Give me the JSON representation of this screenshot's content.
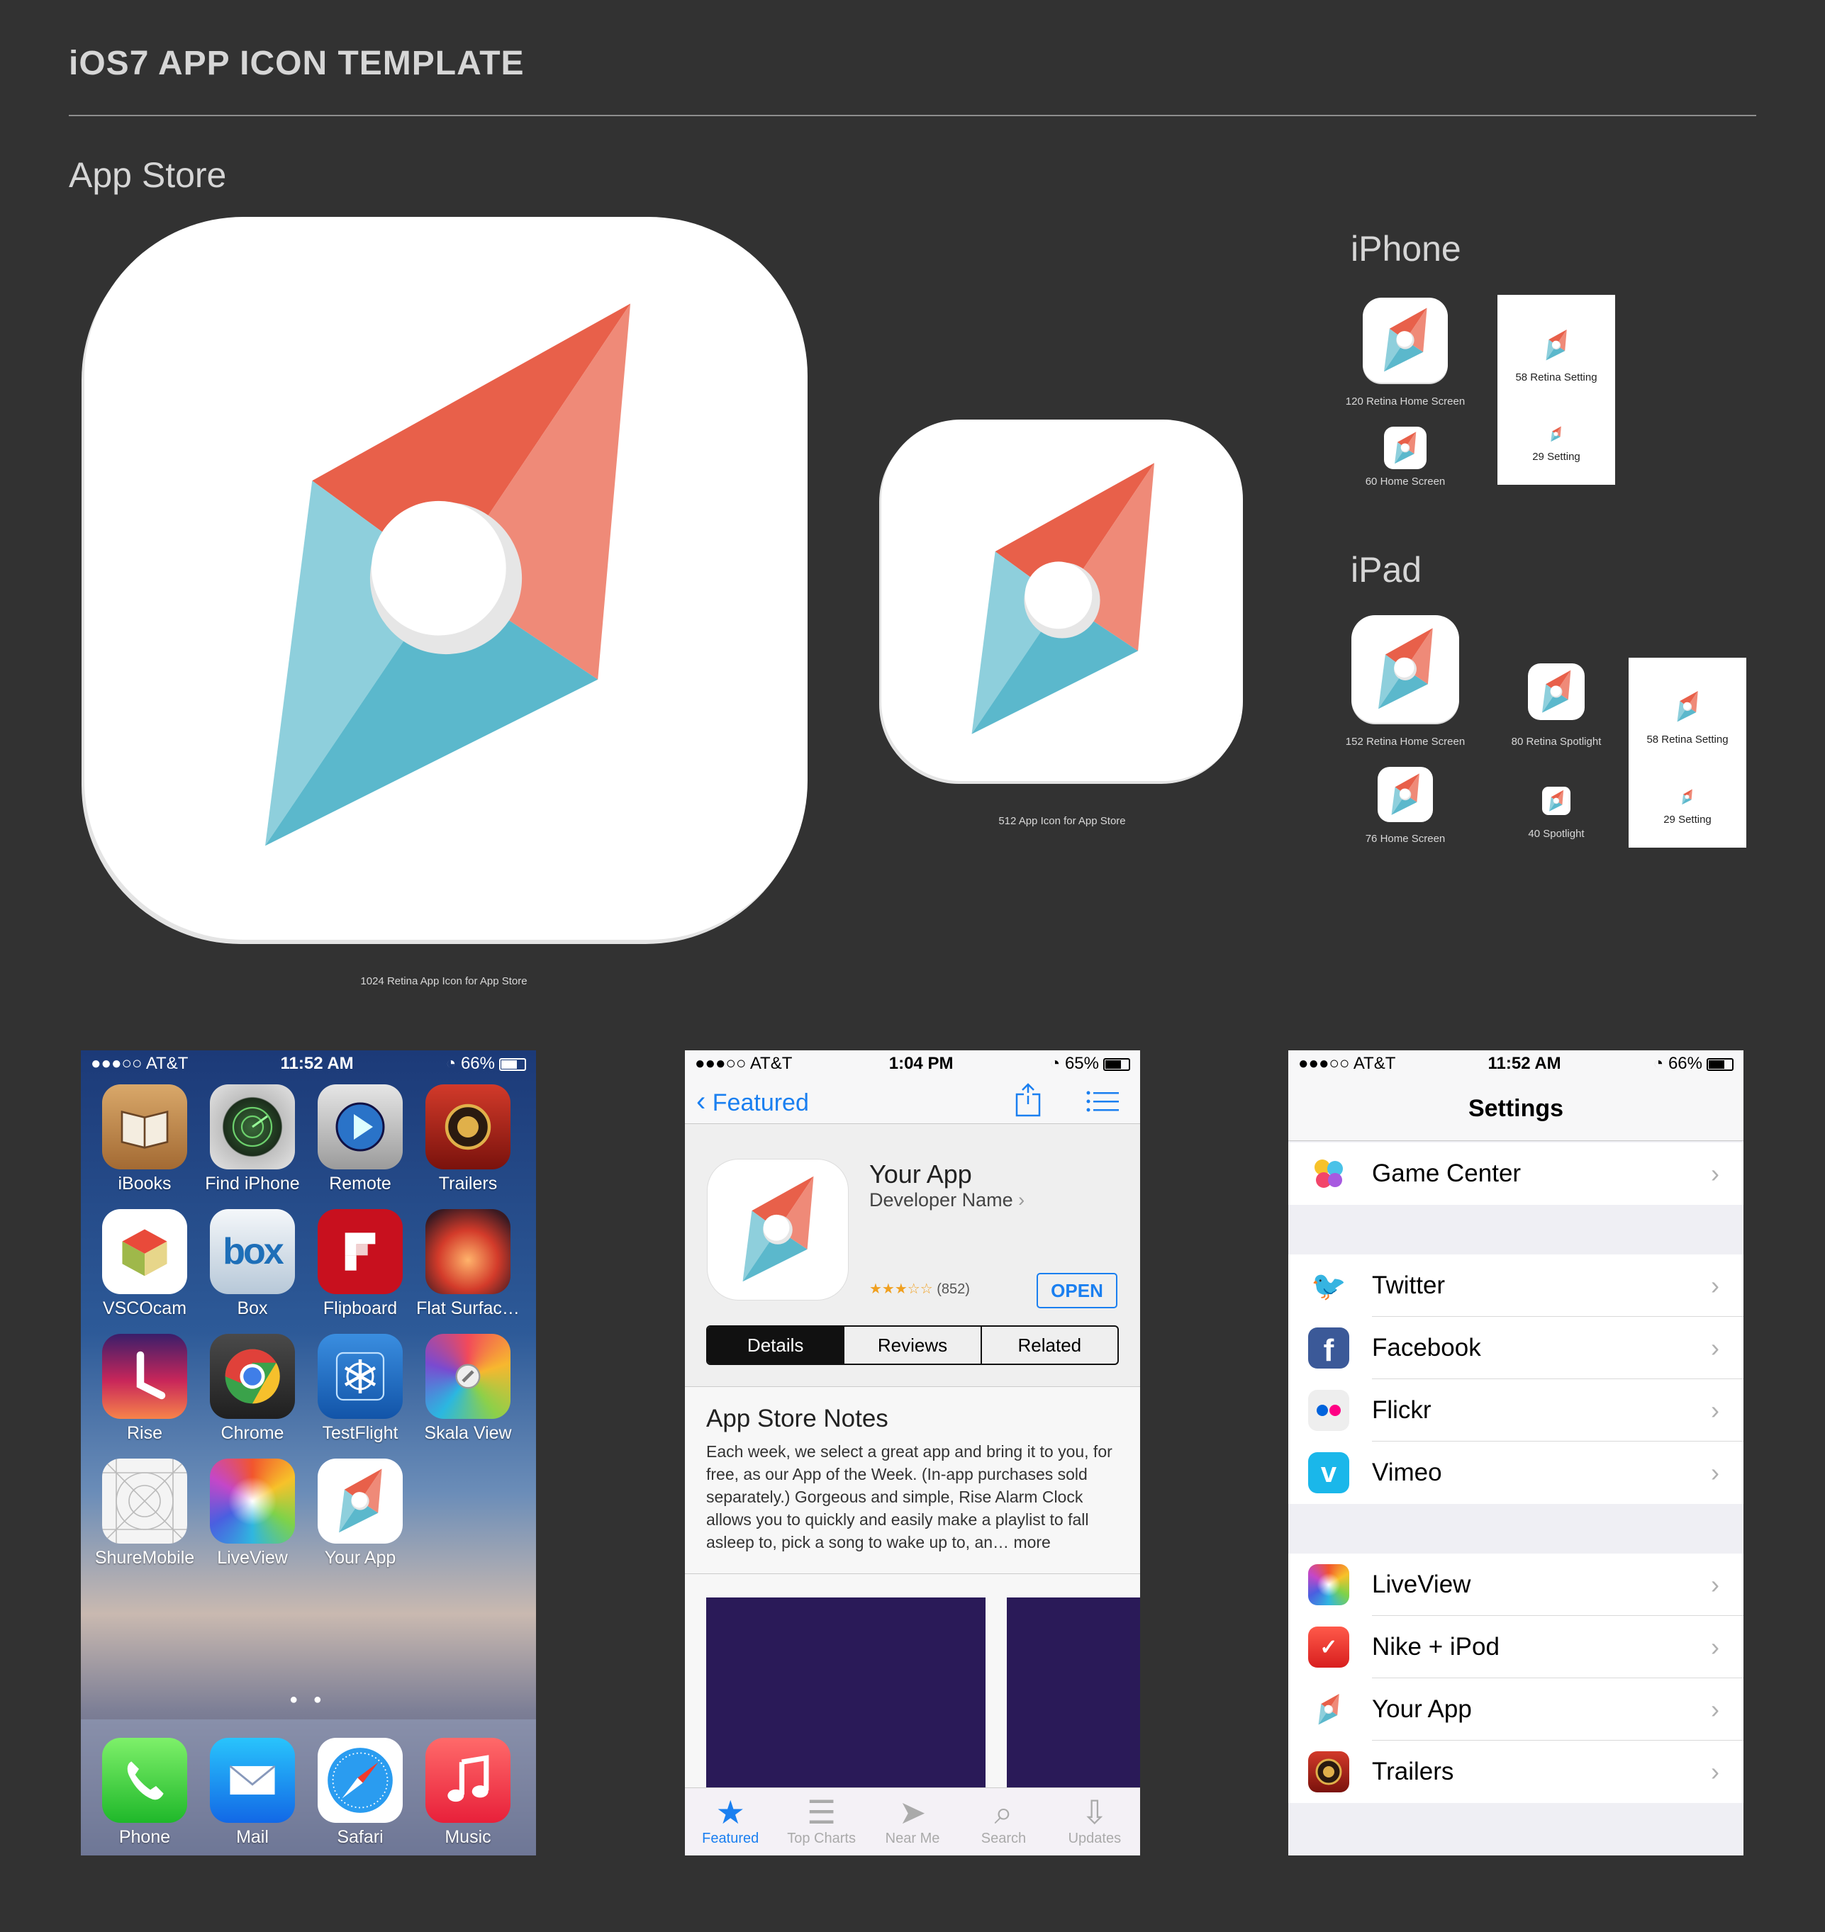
{
  "page": {
    "title": "iOS7 APP ICON TEMPLATE",
    "section_app_store": "App Store",
    "section_iphone": "iPhone",
    "section_ipad": "iPad"
  },
  "captions": {
    "c1024": "1024 Retina App Icon for App Store",
    "c512": "512 App Icon for App Store",
    "c120": "120 Retina Home Screen",
    "c60": "60 Home Screen",
    "c58_iphone": "58 Retina Setting",
    "c29_iphone": "29 Setting",
    "c152": "152 Retina Home Screen",
    "c76": "76 Home Screen",
    "c80": "80 Retina Spotlight",
    "c40": "40 Spotlight",
    "c58_ipad": "58 Retina Setting",
    "c29_ipad": "29 Setting"
  },
  "colors": {
    "background": "#323232",
    "red": "#e8604a",
    "salmon": "#ef8a78",
    "blue": "#5bb8cc",
    "lightblue": "#8ecfdc",
    "ios_blue": "#1a7ff0"
  },
  "home_phone": {
    "status": {
      "carrier": "●●●○○ AT&T",
      "time": "11:52 AM",
      "battery": "66%",
      "battery_level": 0.66
    },
    "apps": [
      {
        "label": "iBooks",
        "icon": "book-icon"
      },
      {
        "label": "Find iPhone",
        "icon": "radar-icon"
      },
      {
        "label": "Remote",
        "icon": "play-icon"
      },
      {
        "label": "Trailers",
        "icon": "film-icon"
      },
      {
        "label": "VSCOcam",
        "icon": "cube-icon"
      },
      {
        "label": "Box",
        "icon": "box-icon"
      },
      {
        "label": "Flipboard",
        "icon": "flipboard-icon"
      },
      {
        "label": "Flat Surfac…",
        "icon": "flatsurface-icon"
      },
      {
        "label": "Rise",
        "icon": "clock-icon"
      },
      {
        "label": "Chrome",
        "icon": "chrome-icon"
      },
      {
        "label": "TestFlight",
        "icon": "testflight-icon"
      },
      {
        "label": "Skala View",
        "icon": "skala-icon"
      },
      {
        "label": "ShureMobile",
        "icon": "grid-icon"
      },
      {
        "label": "LiveView",
        "icon": "liveview-icon"
      },
      {
        "label": "Your App",
        "icon": "compass-icon"
      }
    ],
    "dock": [
      {
        "label": "Phone",
        "icon": "phone-icon"
      },
      {
        "label": "Mail",
        "icon": "mail-icon"
      },
      {
        "label": "Safari",
        "icon": "safari-icon"
      },
      {
        "label": "Music",
        "icon": "music-icon"
      }
    ],
    "page_dots": "● ●"
  },
  "store_phone": {
    "status": {
      "carrier": "●●●○○ AT&T",
      "time": "1:04 PM",
      "battery": "65%",
      "battery_level": 0.65
    },
    "back_label": "Featured",
    "app_name": "Your App",
    "developer": "Developer Name",
    "stars": "★★★☆☆",
    "rating_count": "(852)",
    "open_label": "OPEN",
    "segments": [
      "Details",
      "Reviews",
      "Related"
    ],
    "notes_title": "App Store Notes",
    "notes_body": "Each week, we select a great app and bring it to you, for free, as our App of the Week. (In-app purchases sold separately.) Gorgeous and simple, Rise Alarm Clock allows you to quickly and easily make a playlist to fall asleep to, pick a song to wake up to, an…",
    "more_label": "more",
    "tabs": [
      {
        "label": "Featured",
        "icon": "star-icon"
      },
      {
        "label": "Top Charts",
        "icon": "list-icon"
      },
      {
        "label": "Near Me",
        "icon": "location-icon"
      },
      {
        "label": "Search",
        "icon": "search-icon"
      },
      {
        "label": "Updates",
        "icon": "download-icon"
      }
    ]
  },
  "settings_phone": {
    "status": {
      "carrier": "●●●○○ AT&T",
      "time": "11:52 AM",
      "battery": "66%",
      "battery_level": 0.66
    },
    "title": "Settings",
    "group1": [
      {
        "label": "Game Center",
        "icon": "game-center-icon"
      }
    ],
    "group2": [
      {
        "label": "Twitter",
        "icon": "twitter-icon"
      },
      {
        "label": "Facebook",
        "icon": "facebook-icon"
      },
      {
        "label": "Flickr",
        "icon": "flickr-icon"
      },
      {
        "label": "Vimeo",
        "icon": "vimeo-icon"
      }
    ],
    "group3": [
      {
        "label": "LiveView",
        "icon": "liveview-icon"
      },
      {
        "label": "Nike + iPod",
        "icon": "nike-icon"
      },
      {
        "label": "Your App",
        "icon": "compass-icon"
      },
      {
        "label": "Trailers",
        "icon": "trailers-icon"
      }
    ]
  }
}
